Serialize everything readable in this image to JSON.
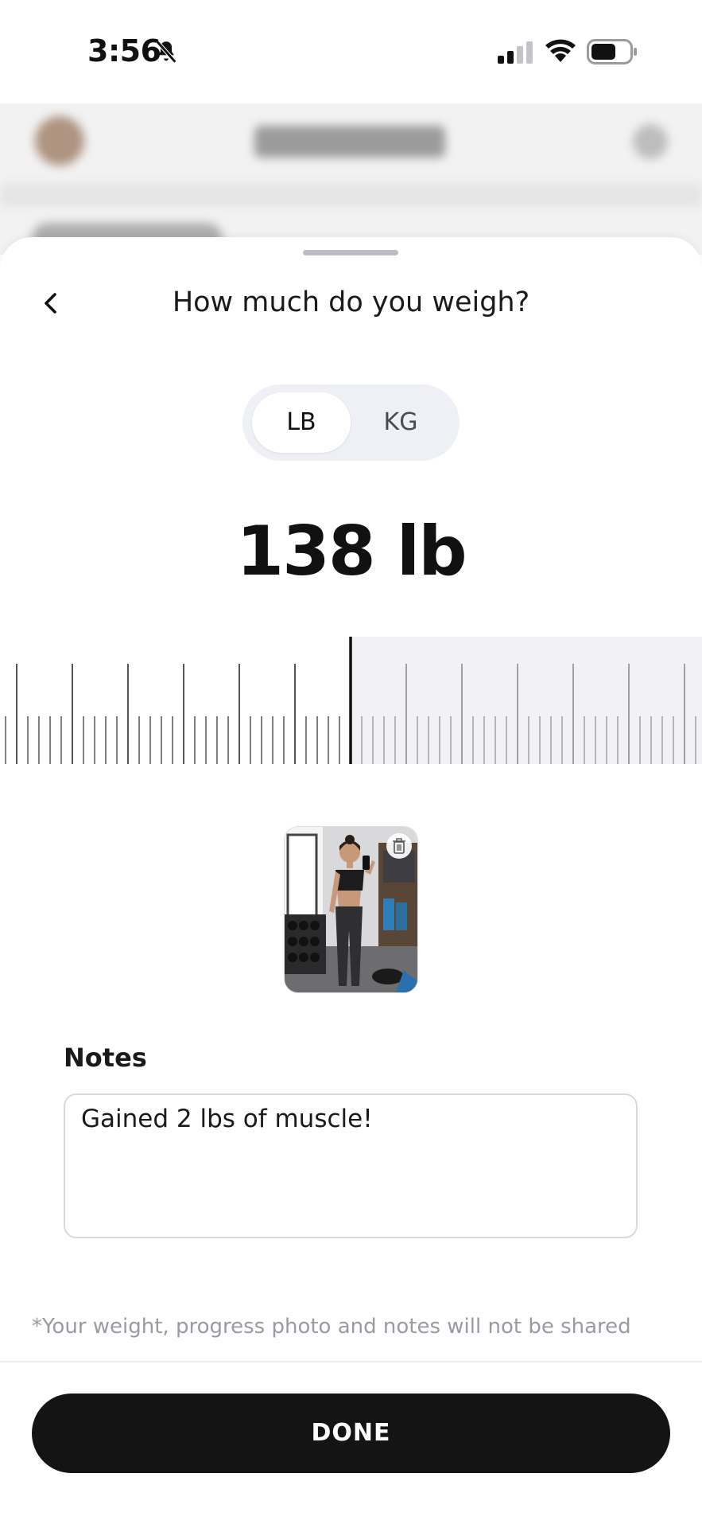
{
  "status_bar": {
    "time": "3:56",
    "icons": [
      "bell-slash-icon",
      "cellular-signal-icon",
      "wifi-icon",
      "battery-icon"
    ]
  },
  "sheet": {
    "title": "How much do you weigh?",
    "back_icon": "chevron-left-icon"
  },
  "unit_toggle": {
    "options": [
      "LB",
      "KG"
    ],
    "selected": "LB"
  },
  "weight": {
    "readout": "138 lb",
    "value": 138,
    "unit": "lb"
  },
  "photo": {
    "delete_icon": "trash-icon"
  },
  "notes": {
    "label": "Notes",
    "value": "Gained 2 lbs of muscle!"
  },
  "privacy_note": "*Your weight, progress photo and notes will not be shared",
  "done_button": "DONE",
  "colors": {
    "accent": "#141414",
    "toggle_bg": "#eef0f6",
    "ruler_track": "#f2f2f5",
    "muted_text": "#9a9aa3"
  }
}
